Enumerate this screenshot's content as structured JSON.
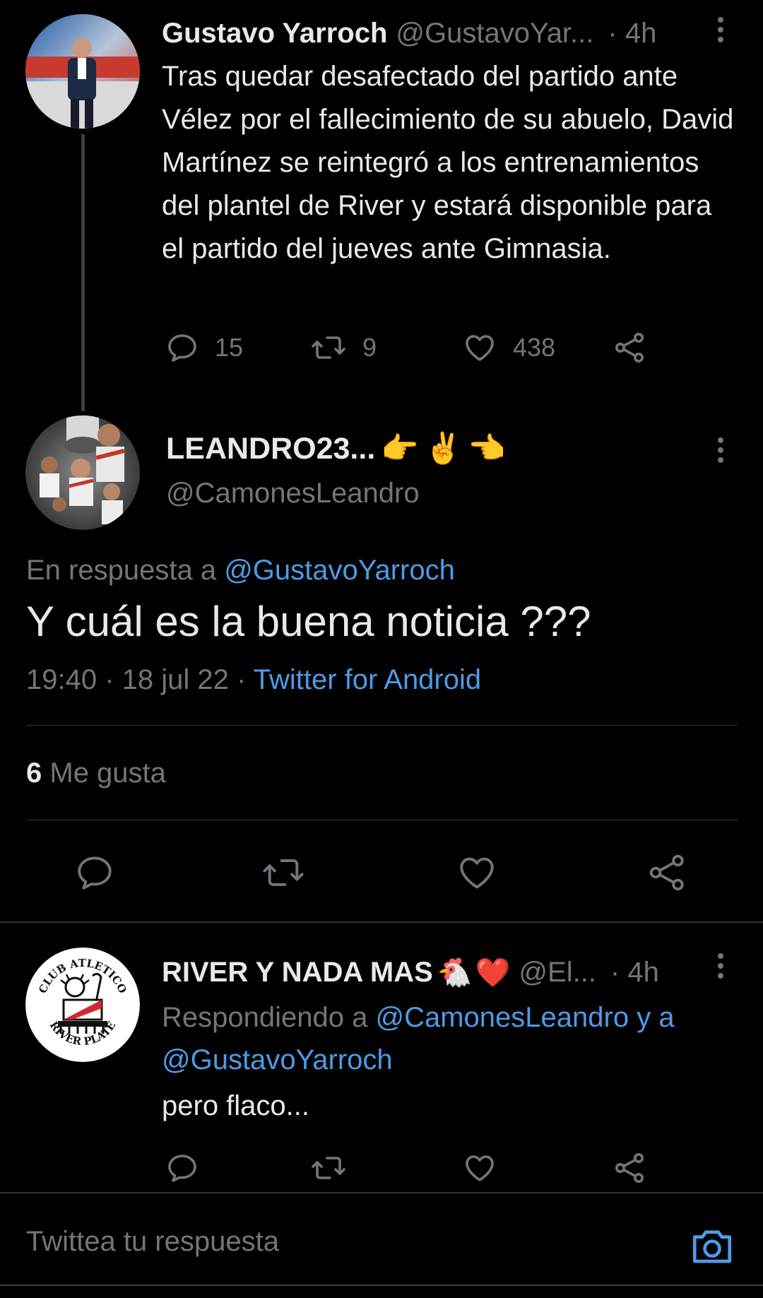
{
  "tweet1": {
    "author_name": "Gustavo Yarroch",
    "author_handle": "@GustavoYar...",
    "time": "· 4h",
    "text": "Tras quedar desafectado del partido ante Vélez por el fallecimiento de su abuelo, David Martínez se reintegró a los entrenamientos del plantel de River y estará disponible para el partido del jueves ante Gimnasia.",
    "replies": "15",
    "retweets": "9",
    "likes": "438"
  },
  "focus_tweet": {
    "author_name": "LEANDRO23...",
    "name_emojis": [
      "👉",
      "✌️",
      "👈"
    ],
    "author_handle": "@CamonesLeandro",
    "reply_prefix": "En respuesta a",
    "reply_to": "@GustavoYarroch",
    "text": "Y cuál es la buena noticia ???",
    "time": "19:40",
    "date": "18 jul 22",
    "separator": "·",
    "source": "Twitter for Android",
    "likes_count": "6",
    "likes_label": "Me gusta"
  },
  "tweet3": {
    "author_name": "RIVER Y NADA MAS",
    "name_emojis": [
      "🐔",
      "❤️"
    ],
    "author_handle": "@El...",
    "time": "· 4h",
    "reply_prefix": "Respondiendo a",
    "reply_to_1": "@CamonesLeandro",
    "reply_joiner": "y a",
    "reply_to_2": "@GustavoYarroch",
    "text": "pero flaco...",
    "avatar_text_top": "CLUB ATLETICO",
    "avatar_text_bottom": "RIVER PLATE"
  },
  "reply_bar": {
    "placeholder": "Twittea tu respuesta"
  },
  "icons": {
    "reply": "reply-icon",
    "retweet": "retweet-icon",
    "like": "heart-icon",
    "share": "share-icon",
    "more": "more-vertical-icon",
    "camera": "camera-icon"
  },
  "colors": {
    "background": "#000000",
    "text_primary": "#e7e9ea",
    "text_secondary": "#71767b",
    "link": "#4d9be6",
    "divider": "#2f3336"
  }
}
